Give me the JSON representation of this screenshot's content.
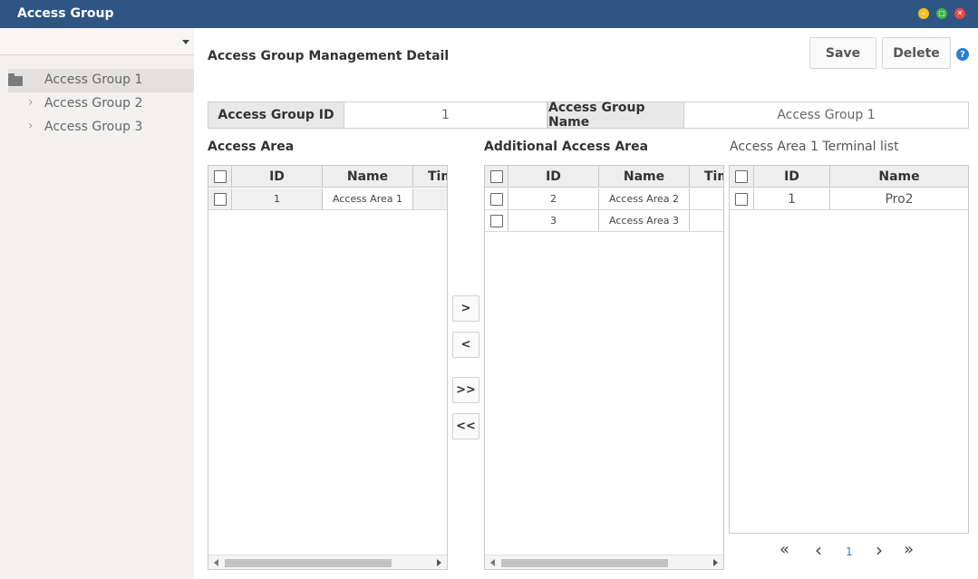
{
  "window": {
    "title": "Access Group"
  },
  "sidebar": {
    "dropdown_value": "",
    "items": [
      {
        "label": "Access Group 1",
        "selected": true,
        "icon": "folder-icon"
      },
      {
        "label": "Access Group 2",
        "selected": false,
        "icon": "chevron-right-icon"
      },
      {
        "label": "Access Group 3",
        "selected": false,
        "icon": "chevron-right-icon"
      }
    ]
  },
  "header": {
    "title": "Access Group Management Detail",
    "save_label": "Save",
    "delete_label": "Delete",
    "help_glyph": "?"
  },
  "form": {
    "id_label": "Access Group ID",
    "id_value": "1",
    "name_label": "Access Group Name",
    "name_value": "Access Group 1"
  },
  "access_area": {
    "title": "Access Area",
    "columns": [
      "ID",
      "Name",
      "Tim"
    ],
    "rows": [
      {
        "id": "1",
        "name": "Access Area 1",
        "time": ""
      }
    ]
  },
  "additional_access_area": {
    "title": "Additional Access Area",
    "columns": [
      "ID",
      "Name",
      "Tim"
    ],
    "rows": [
      {
        "id": "2",
        "name": "Access Area 2",
        "time": ""
      },
      {
        "id": "3",
        "name": "Access Area 3",
        "time": ""
      }
    ]
  },
  "terminal_list": {
    "title": "Access Area 1 Terminal list",
    "columns": [
      "ID",
      "Name"
    ],
    "rows": [
      {
        "id": "1",
        "name": "Pro2"
      }
    ]
  },
  "transfer": {
    "add": ">",
    "remove": "<",
    "add_all": ">>",
    "remove_all": "<<"
  },
  "pager": {
    "first": "«",
    "prev": "‹",
    "page": "1",
    "next": "›",
    "last": "»"
  },
  "colors": {
    "titlebar": "#2f5584",
    "link": "#2a7fd0",
    "minimize": "#f0c020",
    "maximize": "#3cb44a",
    "close": "#e84848"
  }
}
